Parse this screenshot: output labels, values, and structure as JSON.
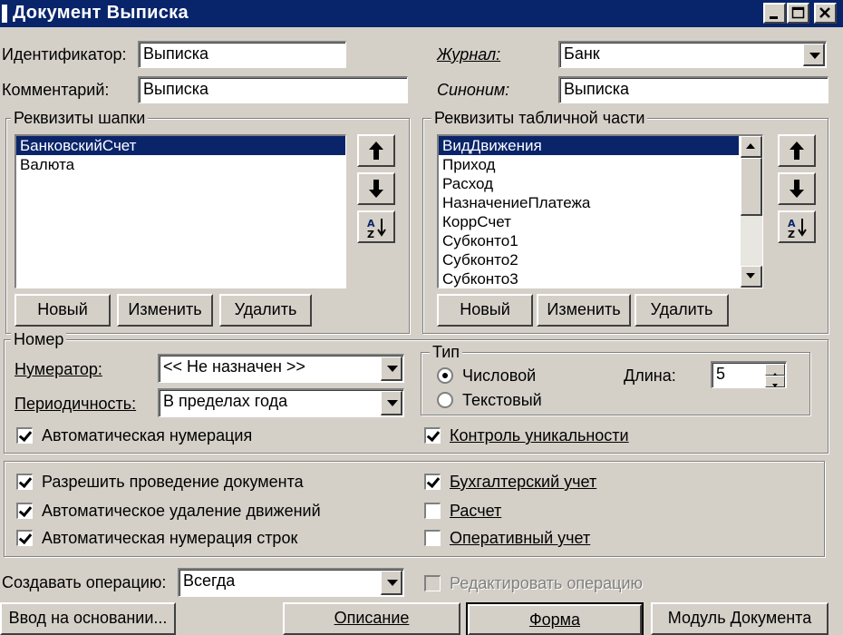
{
  "window": {
    "title": "Документ Выписка"
  },
  "identifier": {
    "label": "Идентификатор:",
    "value": "Выписка"
  },
  "comment": {
    "label": "Комментарий:",
    "value": "Выписка"
  },
  "journal": {
    "label": "Журнал:",
    "value": "Банк"
  },
  "synonym": {
    "label": "Синоним:",
    "value": "Выписка"
  },
  "header_attrs": {
    "title": "Реквизиты шапки",
    "items": [
      "БанковскийСчет",
      "Валюта"
    ],
    "selected_index": 0
  },
  "table_attrs": {
    "title": "Реквизиты табличной части",
    "items": [
      "ВидДвижения",
      "Приход",
      "Расход",
      "НазначениеПлатежа",
      "КоррСчет",
      "Субконто1",
      "Субконто2",
      "Субконто3"
    ],
    "selected_index": 0
  },
  "list_buttons": {
    "new": "Новый",
    "edit": "Изменить",
    "delete": "Удалить"
  },
  "number_group": {
    "title": "Номер",
    "numerator_label": "Нумератор:",
    "numerator_value": "<< Не назначен >>",
    "periodicity_label": "Периодичность:",
    "periodicity_value": "В пределах года",
    "auto_numbering_label": "Автоматическая нумерация",
    "auto_numbering_checked": true
  },
  "type_group": {
    "title": "Тип",
    "numeric_label": "Числовой",
    "text_label": "Текстовый",
    "length_label": "Длина:",
    "length_value": "5",
    "selected": "numeric"
  },
  "uniqueness": {
    "label": "Контроль уникальности",
    "checked": true
  },
  "options_left": [
    {
      "label": "Разрешить проведение документа",
      "checked": true
    },
    {
      "label": "Автоматическое удаление движений",
      "checked": true
    },
    {
      "label": "Автоматическая нумерация строк",
      "checked": true
    }
  ],
  "options_right": [
    {
      "label": "Бухгалтерский учет",
      "checked": true
    },
    {
      "label": "Расчет",
      "checked": false
    },
    {
      "label": "Оперативный учет",
      "checked": false
    }
  ],
  "create_operation": {
    "label": "Создавать операцию:",
    "value": "Всегда"
  },
  "edit_operation": {
    "label": "Редактировать операцию",
    "checked": false
  },
  "bottom_buttons": {
    "input_basis": "Ввод на основании...",
    "description": "Описание",
    "form": "Форма",
    "module": "Модуль Документа"
  }
}
